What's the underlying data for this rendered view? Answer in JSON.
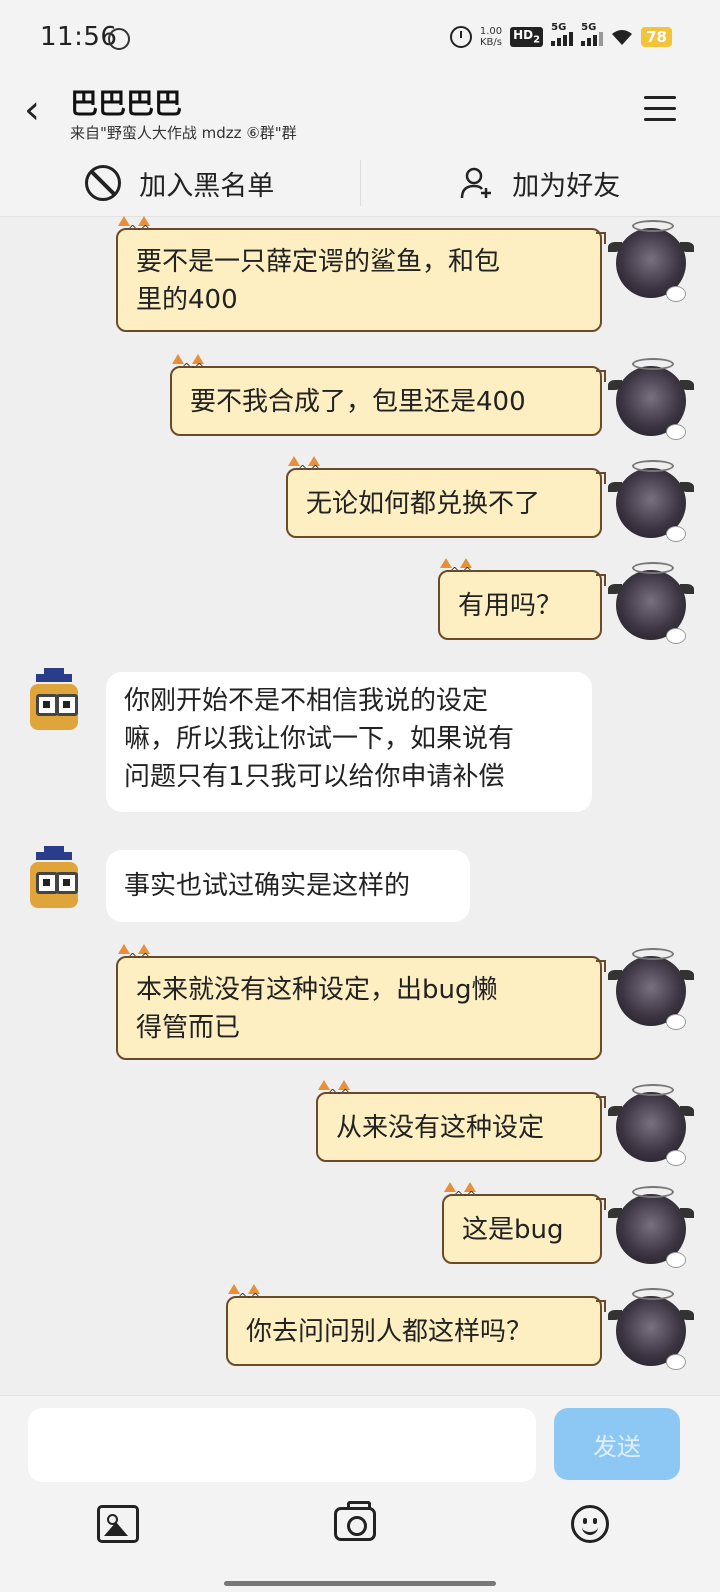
{
  "status_bar": {
    "time": "11:56",
    "net_speed": "1.00\nKB/s",
    "net_speed_value": "1.00",
    "net_speed_unit": "KB/s",
    "hd_label": "HD",
    "hd_sub": "2",
    "signal1_label": "5G",
    "signal2_label": "5G",
    "battery": "78"
  },
  "header": {
    "title": "巴巴巴巴",
    "subtitle": "来自\"野蛮人大作战 mdzz ⑥群\"群"
  },
  "actions": {
    "blacklist_label": "加入黑名单",
    "add_friend_label": "加为好友"
  },
  "messages": [
    {
      "side": "right",
      "lines": [
        "要不是一只薛定谔的鲨鱼，和包",
        "里的400"
      ]
    },
    {
      "side": "right",
      "lines": [
        "要不我合成了，包里还是400"
      ]
    },
    {
      "side": "right",
      "lines": [
        "无论如何都兑换不了"
      ]
    },
    {
      "side": "right",
      "lines": [
        "有用吗？"
      ]
    },
    {
      "side": "left",
      "lines": [
        "你刚开始不是不相信我说的设定",
        "嘛，所以我让你试一下，如果说有",
        "问题只有1只我可以给你申请补偿"
      ]
    },
    {
      "side": "left",
      "lines": [
        "事实也试过确实是这样的"
      ]
    },
    {
      "side": "right",
      "lines": [
        "本来就没有这种设定，出bug懒",
        "得管而已"
      ]
    },
    {
      "side": "right",
      "lines": [
        "从来没有这种设定"
      ]
    },
    {
      "side": "right",
      "lines": [
        "这是bug"
      ]
    },
    {
      "side": "right",
      "lines": [
        "你去问问别人都这样吗？"
      ]
    }
  ],
  "input": {
    "value": "",
    "send_label": "发送"
  },
  "colors": {
    "right_bubble_bg": "#fdefc1",
    "right_bubble_border": "#6b4a2a",
    "send_button_bg": "#8cc8f3",
    "battery_bg": "#f3c33a"
  }
}
